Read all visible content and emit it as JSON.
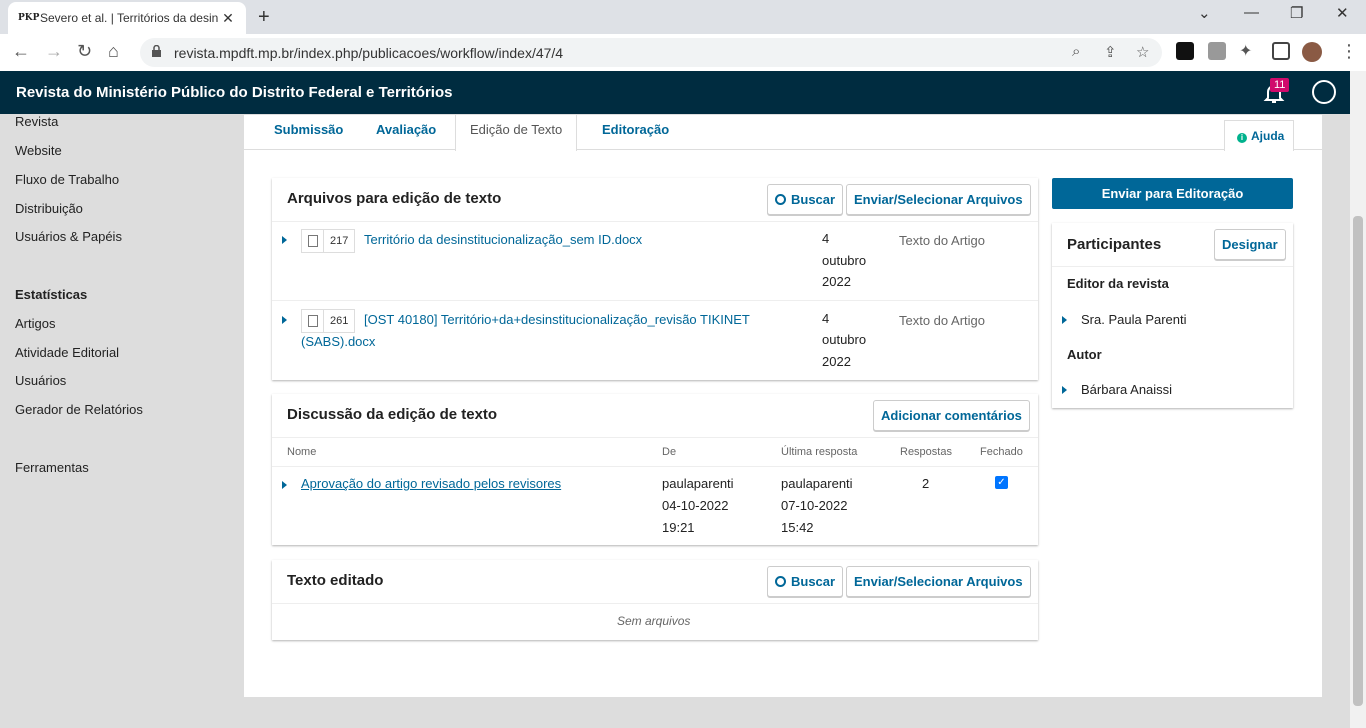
{
  "browser": {
    "tab_favicon": "PKP",
    "tab_title": "Severo et al. | Territórios da desin",
    "url": "revista.mpdft.mp.br/index.php/publicacoes/workflow/index/47/4"
  },
  "header": {
    "site_title": "Revista do Ministério Público do Distrito Federal e Territórios",
    "notification_count": "11"
  },
  "sidebar": {
    "items": [
      "Revista",
      "Website",
      "Fluxo de Trabalho",
      "Distribuição",
      "Usuários & Papéis"
    ],
    "stats_heading": "Estatísticas",
    "stats_items": [
      "Artigos",
      "Atividade Editorial",
      "Usuários",
      "Gerador de Relatórios"
    ],
    "tools": "Ferramentas"
  },
  "workflow_tabs": [
    "Submissão",
    "Avaliação",
    "Edição de Texto",
    "Editoração"
  ],
  "help_label": "Ajuda",
  "copyedit_files": {
    "title": "Arquivos para edição de texto",
    "search_label": "Buscar",
    "upload_label": "Enviar/Selecionar Arquivos",
    "rows": [
      {
        "id": "217",
        "name": "Território da desinstitucionalização_sem ID.docx",
        "date_day": "4",
        "date_month": "outubro",
        "date_year": "2022",
        "type": "Texto do Artigo"
      },
      {
        "id": "261",
        "name_line1": "[OST 40180] Território+da+desinstitucionalização_revisão TIKINET",
        "name_line2": "(SABS).docx",
        "date_day": "4",
        "date_month": "outubro",
        "date_year": "2022",
        "type": "Texto do Artigo"
      }
    ]
  },
  "discussion": {
    "title": "Discussão da edição de texto",
    "add_label": "Adicionar comentários",
    "columns": [
      "Nome",
      "De",
      "Última resposta",
      "Respostas",
      "Fechado"
    ],
    "row": {
      "name": "Aprovação do artigo revisado pelos revisores",
      "from_user": "paulaparenti",
      "from_date": "04-10-2022",
      "from_time": "19:21",
      "last_user": "paulaparenti",
      "last_date": "07-10-2022",
      "last_time": "15:42",
      "replies": "2",
      "closed": true
    }
  },
  "copyedited": {
    "title": "Texto editado",
    "search_label": "Buscar",
    "upload_label": "Enviar/Selecionar Arquivos",
    "empty": "Sem arquivos"
  },
  "send_button": "Enviar para Editoração",
  "participants": {
    "title": "Participantes",
    "assign_label": "Designar",
    "groups": [
      {
        "role": "Editor da revista",
        "name": "Sra. Paula Parenti"
      },
      {
        "role": "Autor",
        "name": "Bárbara Anaissi"
      }
    ]
  },
  "colors": {
    "header_bg": "#002c40",
    "link": "#006798",
    "badge": "#d00a6c",
    "help_icon": "#00b28d"
  }
}
